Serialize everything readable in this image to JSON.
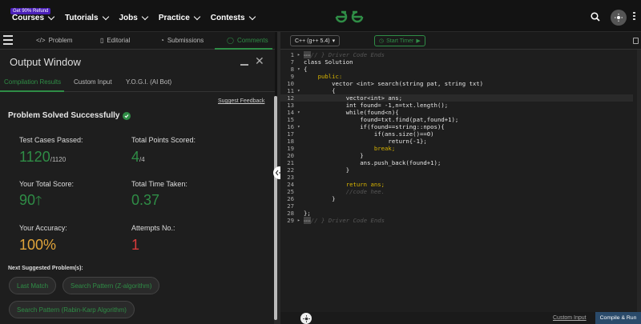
{
  "topbar": {
    "badge": "Get 90% Refund",
    "nav": [
      {
        "label": "Courses"
      },
      {
        "label": "Tutorials"
      },
      {
        "label": "Jobs"
      },
      {
        "label": "Practice"
      },
      {
        "label": "Contests"
      }
    ],
    "icons": [
      "geeksforgeeks-logo",
      "search-icon",
      "theme-toggle-icon",
      "more-menu-icon"
    ]
  },
  "problem_tabs": [
    {
      "label": "Problem",
      "icon": "code-icon"
    },
    {
      "label": "Editorial",
      "icon": "document-icon"
    },
    {
      "label": "Submissions",
      "icon": "clock-icon"
    },
    {
      "label": "Comments",
      "icon": "comment-icon",
      "active": true
    }
  ],
  "output": {
    "title": "Output Window",
    "subtabs": [
      {
        "label": "Compilation Results",
        "active": true
      },
      {
        "label": "Custom Input"
      },
      {
        "label": "Y.O.G.I. (AI Bot)"
      }
    ],
    "suggest_feedback": "Suggest Feedback",
    "status": "Problem Solved Successfully",
    "stats": {
      "test_cases_label": "Test Cases Passed:",
      "test_cases_value": "1120",
      "test_cases_total": "/1120",
      "points_label": "Total Points Scored:",
      "points_value": "4",
      "points_total": "/4",
      "score_label": "Your Total Score:",
      "score_value": "90",
      "time_label": "Total Time Taken:",
      "time_value": "0.37",
      "accuracy_label": "Your Accuracy:",
      "accuracy_value": "100%",
      "attempts_label": "Attempts No.:",
      "attempts_value": "1"
    },
    "next_title": "Next Suggested Problem(s):",
    "suggestions": [
      "Last Match",
      "Search Pattern (Z-algorithm)",
      "Search Pattern (Rabin-Karp Algorithm)"
    ],
    "colors": {
      "accent": "#2f8d46",
      "accuracy": "#e0a43a",
      "attempts": "#d93b3b"
    }
  },
  "editor": {
    "language": "C++ (g++ 5.4)",
    "timer": "Start Timer",
    "custom_input": "Custom Input",
    "compile": "Compile & Run",
    "lines": [
      {
        "n": "1",
        "text": "// } Driver Code Ends"
      },
      {
        "n": "7",
        "text": "class Solution"
      },
      {
        "n": "8",
        "text": "{"
      },
      {
        "n": "9",
        "text": "    public:"
      },
      {
        "n": "10",
        "text": "        vector <int> search(string pat, string txt)"
      },
      {
        "n": "11",
        "text": "        {"
      },
      {
        "n": "12",
        "text": "            vector<int> ans;"
      },
      {
        "n": "13",
        "text": "            int found= -1,n=txt.length();"
      },
      {
        "n": "14",
        "text": "            while(found<n){"
      },
      {
        "n": "15",
        "text": "                found=txt.find(pat,found+1);"
      },
      {
        "n": "16",
        "text": "                if(found==string::npos){"
      },
      {
        "n": "17",
        "text": "                    if(ans.size()==0)"
      },
      {
        "n": "18",
        "text": "                        return{-1};"
      },
      {
        "n": "19",
        "text": "                    break;"
      },
      {
        "n": "20",
        "text": "                }"
      },
      {
        "n": "21",
        "text": "                ans.push_back(found+1);"
      },
      {
        "n": "22",
        "text": "            }"
      },
      {
        "n": "23",
        "text": ""
      },
      {
        "n": "24",
        "text": "            return ans;"
      },
      {
        "n": "25",
        "text": "            //code hee."
      },
      {
        "n": "26",
        "text": "        }"
      },
      {
        "n": "27",
        "text": ""
      },
      {
        "n": "28",
        "text": "};"
      },
      {
        "n": "29",
        "text": "// } Driver Code Ends"
      }
    ]
  }
}
